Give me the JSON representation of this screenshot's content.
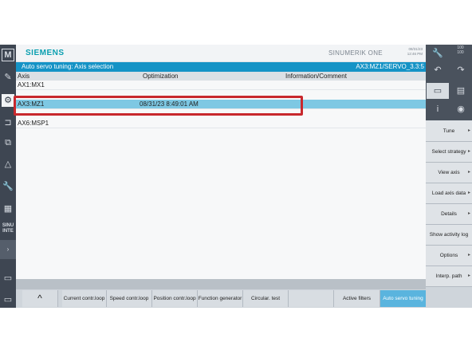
{
  "header": {
    "logo": "SIEMENS",
    "brand": "SINUMERIK ONE",
    "date": "08/31/23",
    "time": "12:46 PM"
  },
  "titlebar": {
    "title": "Auto servo tuning: Axis selection",
    "right": "AX3:MZ1/SERVO_3.3:5"
  },
  "table": {
    "columns": [
      "Axis",
      "Optimization",
      "Information/Comment"
    ],
    "rows": [
      {
        "axis": "AX1:MX1",
        "optimization": "",
        "info": ""
      },
      {
        "axis": "AX3:MZ1",
        "optimization": "08/31/23 8:49:01 AM",
        "info": ""
      },
      {
        "axis": "AX6:MSP1",
        "optimization": "",
        "info": ""
      }
    ]
  },
  "leftbar": {
    "icons": [
      "M",
      "edit",
      "gear",
      "fold",
      "copy",
      "warning",
      "wrench",
      "program",
      "SINU/INTEG",
      "arrow-right",
      "monitor",
      "screen"
    ],
    "labels": {
      "m": "M",
      "sinu": "SINU\nINTE"
    }
  },
  "rightpanel": {
    "percent": "100",
    "percent2": "100",
    "vsoftkeys": [
      {
        "label": "Tune"
      },
      {
        "label": "Select strategy"
      },
      {
        "label": "View axis"
      },
      {
        "label": "Load axis data"
      },
      {
        "label": "Details"
      },
      {
        "label": "Show activity log"
      },
      {
        "label": "Options"
      },
      {
        "label": "Interp. path"
      }
    ]
  },
  "hsoftkeys": [
    {
      "label": "^"
    },
    {
      "label": "Current contr.loop"
    },
    {
      "label": "Speed contr.loop"
    },
    {
      "label": "Position contr.loop"
    },
    {
      "label": "Function generator"
    },
    {
      "label": "Circular. test"
    },
    {
      "label": ""
    },
    {
      "label": "Active filters"
    },
    {
      "label": "Auto servo tuning"
    }
  ],
  "colors": {
    "accent": "#1593c6",
    "selected_row": "#7ec8e3",
    "highlight": "#c8282d",
    "active_key": "#5ab4de"
  }
}
